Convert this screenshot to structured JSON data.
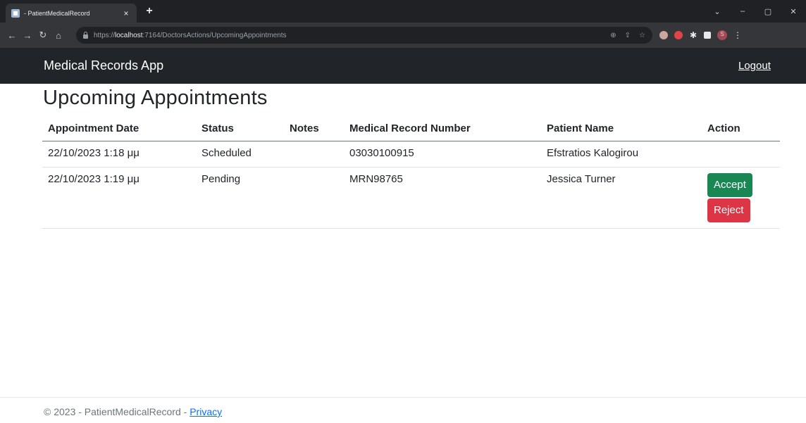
{
  "browser": {
    "tab_title": "- PatientMedicalRecord",
    "tab_close": "×",
    "new_tab": "+",
    "url_prefix": "https://",
    "url_host": "localhost",
    "url_path": ":7164/DoctorsActions/UpcomingAppointments",
    "window_controls": {
      "dropdown": "⌄",
      "minimize": "–",
      "restore": "▢",
      "close": "✕"
    },
    "profile_initial": "S"
  },
  "navbar": {
    "brand": "Medical Records App",
    "logout": "Logout"
  },
  "page": {
    "title": "Upcoming Appointments"
  },
  "table": {
    "headers": {
      "date": "Appointment Date",
      "status": "Status",
      "notes": "Notes",
      "mrn": "Medical Record Number",
      "name": "Patient Name",
      "action": "Action"
    },
    "rows": [
      {
        "date": "22/10/2023 1:18 μμ",
        "status": "Scheduled",
        "notes": "",
        "mrn": "03030100915",
        "name": "Efstratios Kalogirou"
      },
      {
        "date": "22/10/2023 1:19 μμ",
        "status": "Pending",
        "notes": "",
        "mrn": "MRN98765",
        "name": "Jessica Turner",
        "accept_label": "Accept",
        "reject_label": "Reject"
      }
    ]
  },
  "footer": {
    "text": "© 2023 - PatientMedicalRecord - ",
    "privacy": "Privacy"
  },
  "colors": {
    "navbar_bg": "#212529",
    "accept": "#198754",
    "reject": "#dc3545",
    "link": "#0d6efd"
  }
}
